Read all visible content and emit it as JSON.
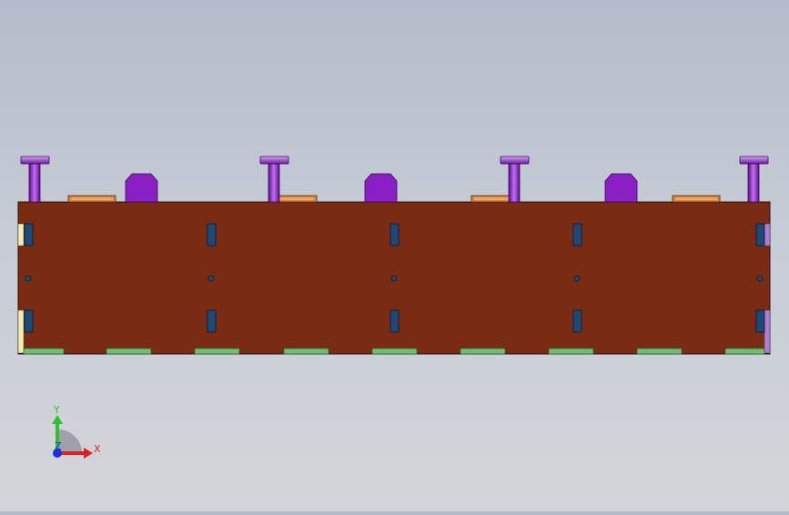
{
  "viewport": {
    "background_top": "#b4bccb",
    "background_bottom": "#d3d5d9"
  },
  "model": {
    "base_plate_color": "#7a2b13",
    "slot_color": "#1c4a78",
    "hole_color": "#1c4a78",
    "pin_color": "#8a1fc4",
    "bracket_color": "#8a1fc4",
    "pad_top_color": "#d9823c",
    "foot_pad_color": "#6fbf73",
    "left_edge_color": "#f3eeb0",
    "right_edge_color": "#b07ad8"
  },
  "triad": {
    "x_label": "X",
    "y_label": "Y",
    "z_label": "Z",
    "x_color": "#e02020",
    "y_color": "#2ec02e",
    "z_color": "#1a2fe0"
  }
}
